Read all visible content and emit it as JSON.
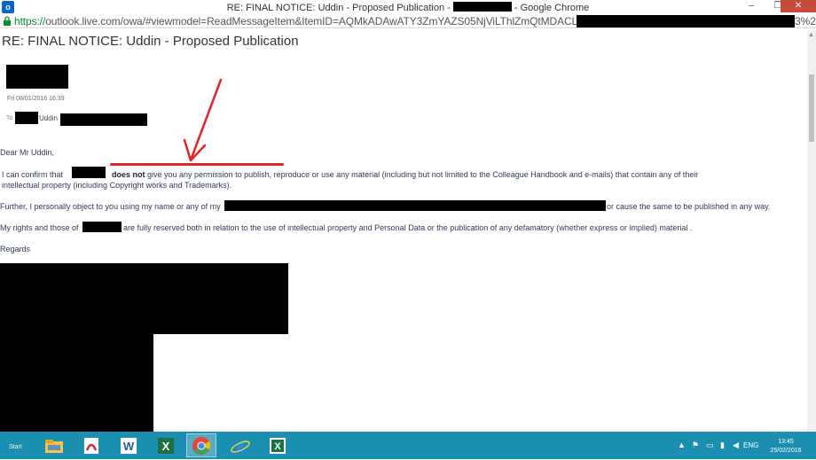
{
  "window": {
    "title_prefix": "RE: FINAL NOTICE: Uddin - Proposed Publication -",
    "title_suffix": "- Google Chrome",
    "app_icon_letter": "o",
    "minimize_glyph": "–",
    "maximize_glyph": "❐",
    "close_glyph": "✕"
  },
  "address": {
    "scheme": "https://",
    "host_path": "outlook.live.com/owa/#viewmodel=ReadMessageItem&ItemID=AQMkADAwATY3ZmYAZS05NjViLThlZmQtMDACLTAwCgBGA",
    "tail": "3%2"
  },
  "email": {
    "subject": "RE: FINAL NOTICE: Uddin - Proposed Publication",
    "sent_date": "Fri 08/01/2016 16:39",
    "to_label": "To",
    "to_name": "Uddin",
    "greeting": "Dear Mr Uddin,",
    "para1_a": "I can confirm that",
    "para1_bold": "does not",
    "para1_b": "give you any permission to publish, reproduce or use any material (including but not limited to the Colleague Handbook and e-mails) that contain any of their",
    "para1_c": "intellectual property (including Copyright works and Trademarks).",
    "para2_a": "Further, I personally object to you using my name or any of my",
    "para2_b": "or cause the same to be published in any way.",
    "para3_a": "My rights and those of",
    "para3_b": "are fully reserved both in relation to the use of intellectual property and Personal Data or the publication of any defamatory (whether express or implied) material .",
    "closing": "Regards"
  },
  "taskbar": {
    "start_label": "Start",
    "items": [
      {
        "name": "file-explorer",
        "glyph": "▭",
        "color": "#f3c74a"
      },
      {
        "name": "acrobat",
        "glyph": "⌁",
        "color": "#d6262b"
      },
      {
        "name": "word",
        "glyph": "W",
        "color": "#2b5797"
      },
      {
        "name": "excel",
        "glyph": "X",
        "color": "#1e7145"
      },
      {
        "name": "chrome",
        "glyph": "◉",
        "color": "#e8453c"
      },
      {
        "name": "ie",
        "glyph": "e",
        "color": "#1e90ff"
      },
      {
        "name": "excel-2",
        "glyph": "X",
        "color": "#1e7145"
      }
    ],
    "language": "ENG",
    "time": "13:45",
    "date": "25/02/2016"
  },
  "colors": {
    "accent_red": "#e0242c",
    "taskbar": "#1b8fb0",
    "body_text": "#2e3a57"
  }
}
